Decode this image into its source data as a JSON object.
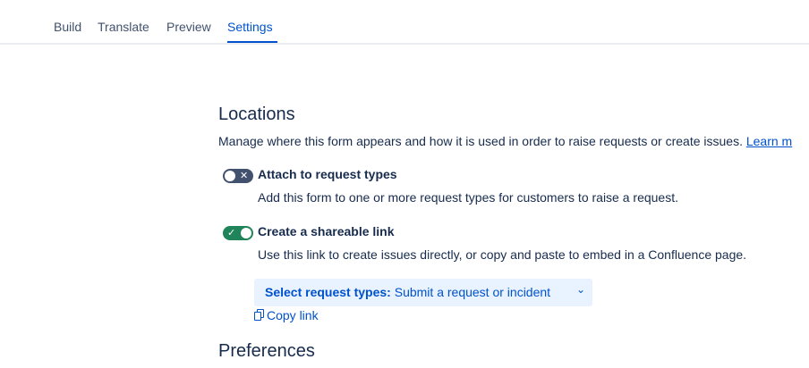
{
  "tabs": [
    {
      "label": "Build"
    },
    {
      "label": "Translate"
    },
    {
      "label": "Preview"
    },
    {
      "label": "Settings",
      "active": true
    }
  ],
  "locations": {
    "title": "Locations",
    "description": "Manage where this form appears and how it is used in order to raise requests or create issues.",
    "learn_more": "Learn m",
    "options": [
      {
        "label": "Attach to request types",
        "help": "Add this form to one or more request types for customers to raise a request.",
        "enabled": false,
        "toggle_icon": "x-icon"
      },
      {
        "label": "Create a shareable link",
        "help": "Use this link to create issues directly, or copy and paste to embed in a Confluence page.",
        "enabled": true,
        "toggle_icon": "check-icon"
      }
    ],
    "select": {
      "label": "Select request types:",
      "value": "Submit a request or incident"
    },
    "copy_link": "Copy link"
  },
  "preferences": {
    "title": "Preferences"
  },
  "colors": {
    "accent": "#0052cc",
    "toggle_on": "#1f845a",
    "toggle_off": "#42526e",
    "select_bg": "#e9f2ff"
  }
}
